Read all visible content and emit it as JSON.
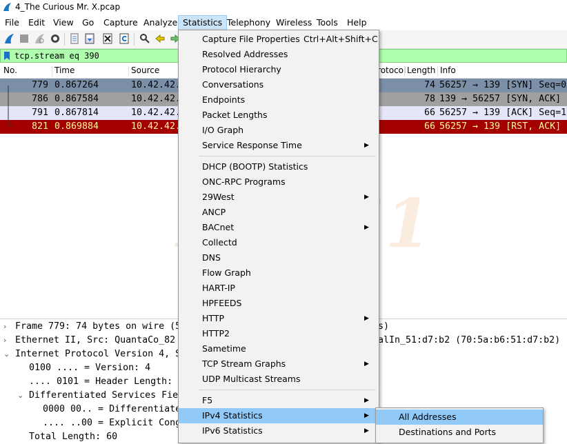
{
  "window": {
    "title": "4_The Curious Mr. X.pcap"
  },
  "menubar": [
    "File",
    "Edit",
    "View",
    "Go",
    "Capture",
    "Analyze",
    "Statistics",
    "Telephony",
    "Wireless",
    "Tools",
    "Help"
  ],
  "filter": {
    "value": "tcp.stream eq 390"
  },
  "columns": [
    "No.",
    "Time",
    "Source",
    "Protocol",
    "Length",
    "Info"
  ],
  "packets": [
    {
      "no": "779",
      "time": "0.867264",
      "src": "10.42.42.",
      "len": "74",
      "info": "56257 → 139 [SYN] Seq=0"
    },
    {
      "no": "786",
      "time": "0.867584",
      "src": "10.42.42.",
      "len": "78",
      "info": "139 → 56257 [SYN, ACK]"
    },
    {
      "no": "791",
      "time": "0.867814",
      "src": "10.42.42.",
      "len": "66",
      "info": "56257 → 139 [ACK] Seq=1"
    },
    {
      "no": "821",
      "time": "0.869884",
      "src": "10.42.42.",
      "len": "66",
      "info": "56257 → 139 [RST, ACK]"
    }
  ],
  "watermark": "D4tai1",
  "details": {
    "l1a": "Frame 779: 74 bytes on wire (5",
    "l1b": "s)",
    "l2a": "Ethernet II, Src: QuantaCo_82",
    "l2b": "alIn_51:d7:b2 (70:5a:b6:51:d7:b2)",
    "l3": "Internet Protocol Version 4, S",
    "l4": "0100 .... = Version: 4",
    "l5": ".... 0101 = Header Length:",
    "l6": "Differentiated Services Fie",
    "l7": "0000 00.. = Differentiate",
    "l8": ".... ..00 = Explicit Cong",
    "l9": "Total Length: 60"
  },
  "stats_menu": {
    "capture_props": "Capture File Properties",
    "capture_props_shortcut": "Ctrl+Alt+Shift+C",
    "resolved": "Resolved Addresses",
    "hierarchy": "Protocol Hierarchy",
    "conversations": "Conversations",
    "endpoints": "Endpoints",
    "pktlen": "Packet Lengths",
    "io": "I/O Graph",
    "srt": "Service Response Time",
    "dhcp": "DHCP (BOOTP) Statistics",
    "oncrpc": "ONC-RPC Programs",
    "w29": "29West",
    "ancp": "ANCP",
    "bacnet": "BACnet",
    "collectd": "Collectd",
    "dns": "DNS",
    "flow": "Flow Graph",
    "hartip": "HART-IP",
    "hpfeeds": "HPFEEDS",
    "http": "HTTP",
    "http2": "HTTP2",
    "sametime": "Sametime",
    "tcpgraphs": "TCP Stream Graphs",
    "udpmc": "UDP Multicast Streams",
    "f5": "F5",
    "ipv4": "IPv4 Statistics",
    "ipv6": "IPv6 Statistics"
  },
  "ipv4_submenu": {
    "all": "All Addresses",
    "dest": "Destinations and Ports"
  },
  "colors": {
    "accent": "#91c9f7",
    "filter_ok": "#afffaf",
    "rst_row": "#a40000"
  }
}
